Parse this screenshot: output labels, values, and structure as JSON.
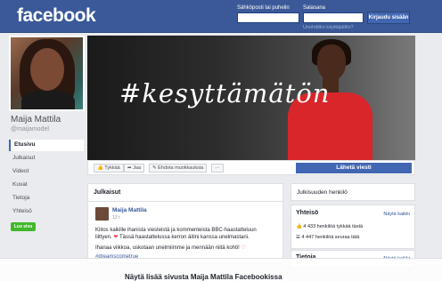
{
  "header": {
    "logo": "facebook",
    "email_label": "Sähköposti tai puhelin",
    "password_label": "Salasana",
    "login_button": "Kirjaudu sisään",
    "forgot_link": "Unohditko käyttäjätilin?"
  },
  "profile": {
    "name": "Maija Mattila",
    "username": "@maijamodel"
  },
  "sidebar": {
    "items": [
      "Etusivu",
      "Julkaisut",
      "Videot",
      "Kuvat",
      "Tietoja",
      "Yhteisö"
    ],
    "like_page": "Luo sivu"
  },
  "cover": {
    "hashtag": "#kesyttämätön"
  },
  "actions": {
    "like": "Tykkää",
    "share": "Jaa",
    "suggest": "Ehdota muokkauksia",
    "more": "···",
    "send": "Lähetä viesti"
  },
  "posts": {
    "title": "Julkaisut",
    "author": "Maija Mattila",
    "date": "13 t ·",
    "line1": "Kiitos kaikille ihanista viesteistä ja kommenteista BBC-haastatteluun",
    "line2a": "liittyen.",
    "line2b": "Tässä haastattelussa kerron äitini kanssa unelmastani.",
    "line3a": "Ihanaa viikkoa, uskotaan unelmiimme ja mennään niitä kohti!",
    "hashtag": "#dreamscometrue"
  },
  "right": {
    "public_person": "Julkisuuden henkilö",
    "community_title": "Yhteisö",
    "see_all": "Näytä kaikki",
    "likes": "4 433 henkilöä tykkää tästä",
    "follows": "4 447 henkilöä seuraa tätä",
    "info_title": "Tietoja",
    "see_all2": "Näytä kaikki"
  },
  "overlay": {
    "text": "Näytä lisää sivusta Maija Mattila Facebookissa"
  }
}
